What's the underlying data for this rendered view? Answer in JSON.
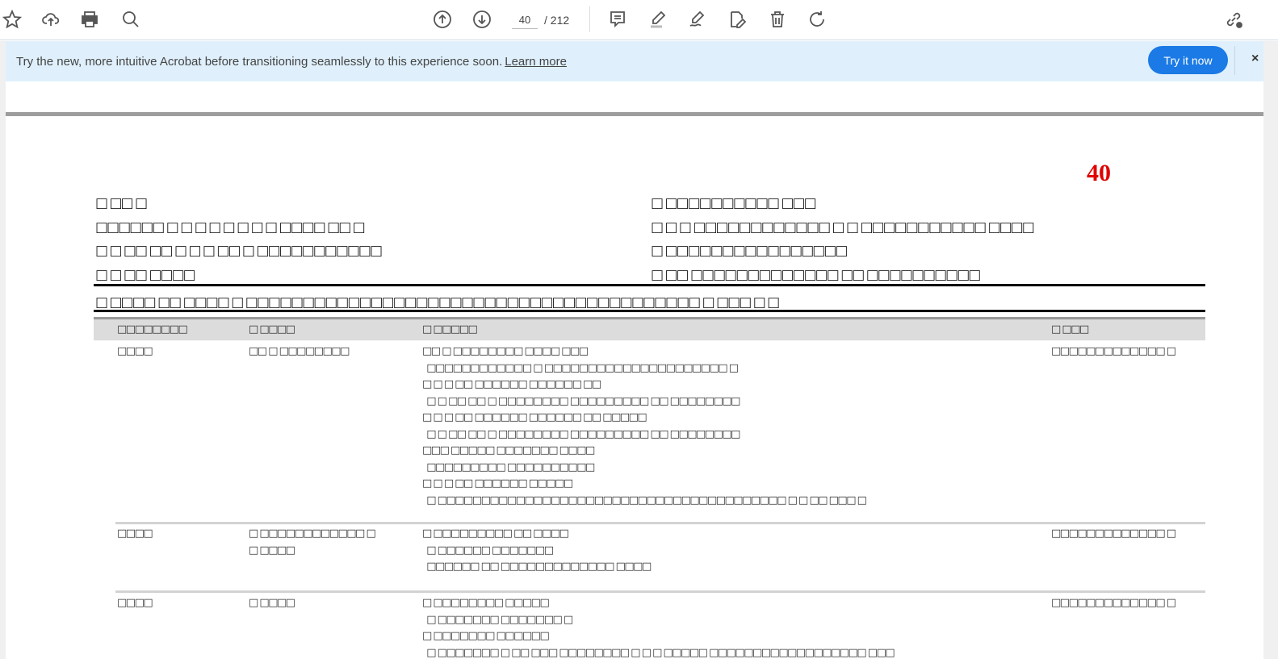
{
  "toolbar": {
    "page_current": "40",
    "page_total": "/ 212"
  },
  "banner": {
    "message": "Try the new, more intuitive Acrobat before transitioning seamlessly to this experience soon.",
    "link": "Learn more",
    "button": "Try it now",
    "close": "×"
  },
  "document": {
    "page_number": "40",
    "header_left": [
      "□ □□ □",
      "□□□□□□ □ □ □ □ □ □ □ □ □□□□ □□ □",
      "□ □ □□ □□ □ □ □ □□ □ □□□□□□□□□□□",
      "□ □ □□ □□□□"
    ],
    "header_right": [
      "□ □□□□□□□□□□ □□□",
      "□ □ □ □□□□□□□□□□□□ □ □ □□□□□□□□□□□ □□□□",
      "□ □□□□□□□□□□□□□□□□",
      "□ □□ □□□□□□□□□□□□□ □□ □□□□□□□□□□"
    ],
    "subtitle": "□ □□□□ □□ □□□□ □ □□□□□□□□□□□□□□□□□□□□□□□□□□□□□□□□□□□□□□□□ □ □□□ □ □",
    "columns": [
      "□□□□□□□□",
      "□ □□□□",
      "□ □□□□□",
      "□ □□□"
    ],
    "rows": [
      {
        "c1": "□□□□",
        "c2": "□□ □ □□□□□□□□",
        "c3": [
          "□□ □ □□□□□□□□ □□□□ □□□",
          "  □□□□□□□□□□□□ □ □□□□□□□□□□□□□□□□□□□□□ □",
          "□ □ □ □□ □□□□□□ □□□□□□ □□",
          "  □ □ □□ □□ □ □□□□□□□□ □□□□□□□□□ □□ □□□□□□□□",
          "□ □ □ □□ □□□□□□ □□□□□□ □□ □□□□□",
          "  □ □ □□ □□ □ □□□□□□□□ □□□□□□□□□ □□ □□□□□□□□",
          "□□□ □□□□□ □□□□□□□ □□□□",
          "  □□□□□□□□□ □□□□□□□□□□",
          "□ □ □ □□ □□□□□□ □□□□□",
          "  □ □□□□□□□□□□□□□□□□□□□□□□□□□□□□□□□□□□□□□□□□ □ □ □□ □□□ □"
        ],
        "c4": "□□□□□□□□□□□□□ □"
      },
      {
        "c1": "□□□□",
        "c2": [
          "□ □□□□□□□□□□□□ □",
          "□ □□□□"
        ],
        "c3": [
          "□ □□□□□□□□□ □□ □□□□",
          "  □ □□□□□□ □□□□□□□",
          "  □□□□□□ □□ □□□□□□□□□□□□□ □□□□"
        ],
        "c4": "□□□□□□□□□□□□□ □"
      },
      {
        "c1": "□□□□",
        "c2": "□ □□□□",
        "c3": [
          "□ □□□□□□□□ □□□□□",
          "  □ □□□□□□□ □□□□□□□ □",
          "□ □□□□□□□ □□□□□□",
          "  □ □□□□□□□ □ □□ □□□ □□□□□□□□ □ □ □ □□□□□ □□□□□□□□□□□□□□□□□□ □□□"
        ],
        "c4": "□□□□□□□□□□□□□ □"
      }
    ]
  }
}
